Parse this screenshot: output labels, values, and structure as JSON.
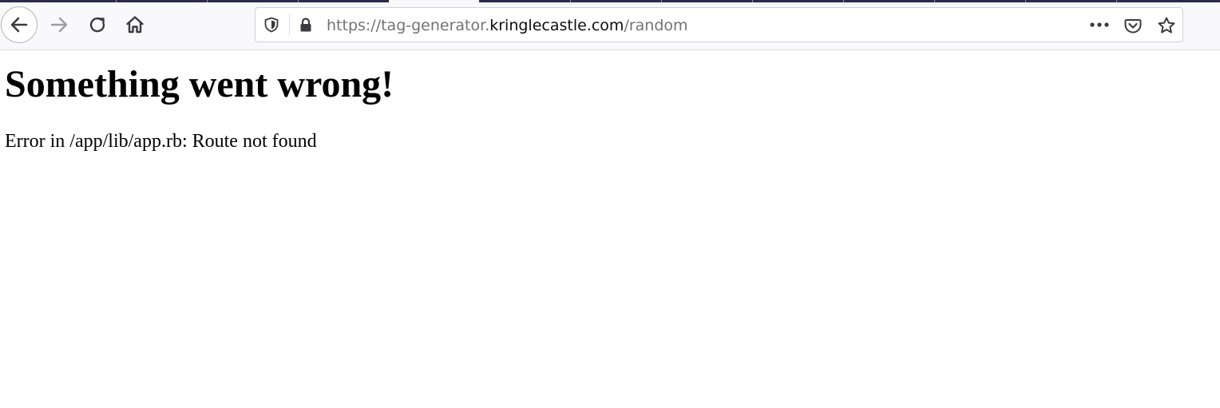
{
  "browser": {
    "url": {
      "prefix": "https://tag-generator.",
      "domain": "kringlecastle.com",
      "path": "/random"
    },
    "icons": {
      "back": "back-arrow-icon",
      "forward": "forward-arrow-icon",
      "reload": "reload-icon",
      "home": "home-icon",
      "tracking": "shield-icon",
      "secure": "lock-icon",
      "page_actions": "more-dots-icon",
      "pocket": "pocket-icon",
      "bookmark": "star-icon"
    },
    "colors": {
      "toolbar_bg": "#f9f9fb",
      "url_dim": "#737373",
      "url_domain": "#0c0c0d",
      "tabstrip": "#2b2a4c"
    }
  },
  "page": {
    "heading": "Something went wrong!",
    "message": "Error in /app/lib/app.rb: Route not found"
  }
}
